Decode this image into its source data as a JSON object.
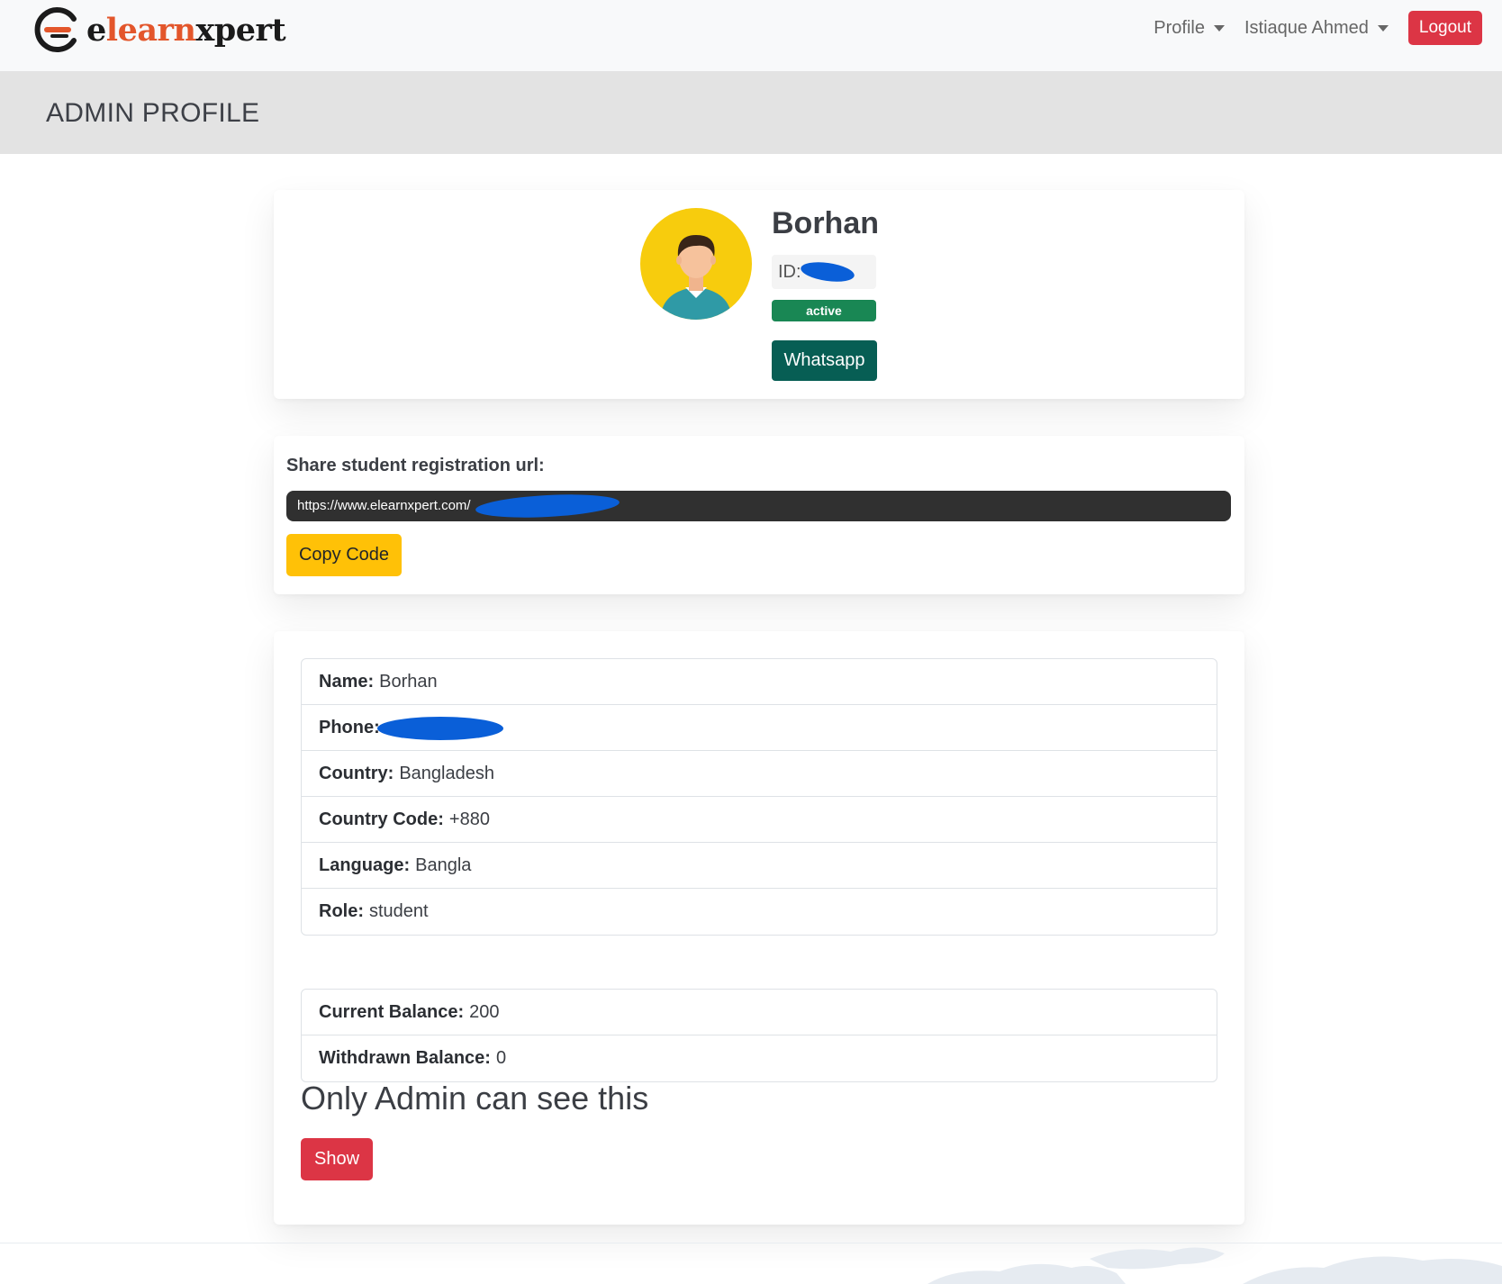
{
  "brand": {
    "prefix": "e",
    "accent": "learn",
    "suffix": "xpert"
  },
  "nav": {
    "profile_label": "Profile",
    "user_label": "Istiaque Ahmed",
    "logout_label": "Logout"
  },
  "page": {
    "title": "ADMIN PROFILE"
  },
  "profile": {
    "name": "Borhan",
    "id_label": "ID:",
    "status": "active",
    "whatsapp_label": "Whatsapp"
  },
  "share": {
    "label": "Share student registration url:",
    "url": "https://www.elearnxpert.com/",
    "copy_label": "Copy Code"
  },
  "details": [
    {
      "label": "Name:",
      "value": "Borhan"
    },
    {
      "label": "Phone:",
      "value": ""
    },
    {
      "label": "Country:",
      "value": "Bangladesh"
    },
    {
      "label": "Country Code:",
      "value": "+880"
    },
    {
      "label": "Language:",
      "value": "Bangla"
    },
    {
      "label": "Role:",
      "value": "student"
    }
  ],
  "balances": [
    {
      "label": "Current Balance:",
      "value": "200"
    },
    {
      "label": "Withdrawn Balance:",
      "value": "0"
    }
  ],
  "admin_note": "Only Admin can see this",
  "show_label": "Show",
  "colors": {
    "brand_accent": "#e3562b",
    "danger": "#dc3545",
    "success": "#198754",
    "whatsapp": "#075e54",
    "warning": "#ffc107",
    "redaction": "#0a5fd8"
  }
}
